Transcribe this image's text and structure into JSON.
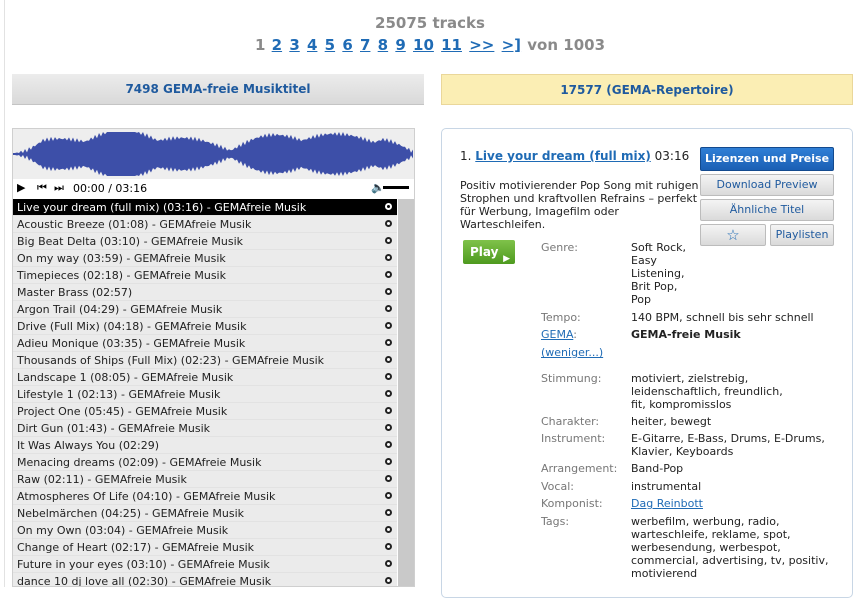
{
  "summary": {
    "tracks": "25075 tracks"
  },
  "pagination": {
    "current": "1",
    "pages": [
      "2",
      "3",
      "4",
      "5",
      "6",
      "7",
      "8",
      "9",
      "10",
      "11"
    ],
    "next": ">>",
    "last": ">]",
    "total": "von 1003"
  },
  "tabs": {
    "free": "7498 GEMA-freie Musiktitel",
    "repertoire": "17577 (GEMA-Repertoire)"
  },
  "player": {
    "time": "00:00 / 03:16",
    "icons": [
      "play-icon",
      "prev-icon",
      "next-icon",
      "volume-icon",
      "download-icon"
    ],
    "tracks": [
      "Live your dream (full mix) (03:16) - GEMAfreie Musik",
      "Acoustic Breeze (01:08) - GEMAfreie Musik",
      "Big Beat Delta (03:10) - GEMAfreie Musik",
      "On my way (03:59) - GEMAfreie Musik",
      "Timepieces (02:18) - GEMAfreie Musik",
      "Master Brass (02:57)",
      "Argon Trail (04:29) - GEMAfreie Musik",
      "Drive (Full Mix) (04:18) - GEMAfreie Musik",
      "Adieu Monique (03:35) - GEMAfreie Musik",
      "Thousands of Ships (Full Mix) (02:23) - GEMAfreie Musik",
      "Landscape 1 (08:05) - GEMAfreie Musik",
      "Lifestyle 1 (02:13) - GEMAfreie Musik",
      "Project One (05:45) - GEMAfreie Musik",
      "Dirt Gun (01:43) - GEMAfreie Musik",
      "It Was Always You (02:29)",
      "Menacing dreams (02:09) - GEMAfreie Musik",
      "Raw (02:11) - GEMAfreie Musik",
      "Atmospheres Of Life (04:10) - GEMAfreie Musik",
      "Nebelmärchen (04:25) - GEMAfreie Musik",
      "On my Own (03:04) - GEMAfreie Musik",
      "Change of Heart (02:17) - GEMAfreie Musik",
      "Future in your eyes (03:10) - GEMAfreie Musik",
      "dance 10 dj love all (02:30) - GEMAfreie Musik"
    ]
  },
  "detail": {
    "index": "1.",
    "title": "Live your dream (full mix)",
    "duration": "03:16",
    "description": "Positiv motivierender Pop Song mit ruhigen Strophen und kraftvollen Refrains – perfekt für Werbung, Imagefilm oder Warteschleifen.",
    "buttons": {
      "license": "Lizenzen und Preise",
      "preview": "Download Preview",
      "similar": "Ähnliche Titel",
      "star": "☆",
      "playlists": "Playlisten",
      "play": "Play"
    },
    "meta": {
      "genre_label": "Genre:",
      "genre": "Soft Rock, Easy Listening, Brit Pop, Pop",
      "tempo_label": "Tempo:",
      "tempo": "140 BPM, schnell bis sehr schnell",
      "gema_label": "GEMA",
      "gema_colon": ":",
      "gema": "GEMA-freie Musik",
      "less": "(weniger...)",
      "mood_label": "Stimmung:",
      "mood": "motiviert, zielstrebig, leidenschaftlich, freundlich, fit, kompromisslos",
      "character_label": "Charakter:",
      "character": "heiter, bewegt",
      "instrument_label": "Instrument:",
      "instrument": "E-Gitarre, E-Bass, Drums, E-Drums, Klavier, Keyboards",
      "arrangement_label": "Arrangement:",
      "arrangement": "Band-Pop",
      "vocal_label": "Vocal:",
      "vocal": "instrumental",
      "composer_label": "Komponist:",
      "composer": "Dag Reinbott",
      "tags_label": "Tags:",
      "tags": "werbefilm, werbung, radio, warteschleife, reklame, spot, werbesendung, werbespot, commercial, advertising, tv, positiv, motivierend"
    }
  },
  "colors": {
    "link": "#1f6bb5",
    "waveform": "#3d4fa8",
    "play_green": "#5aa62a",
    "repertoire_bg": "#fbeeb4"
  }
}
